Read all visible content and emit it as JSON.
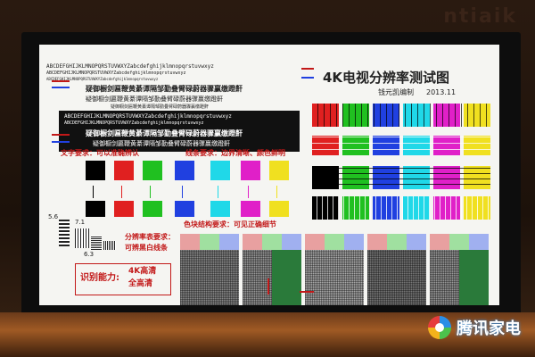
{
  "wall_sign": "ntiaik",
  "chart": {
    "title": "4K电视分辨率测试图",
    "author": "钱元凯编制",
    "year": "2013.11",
    "latin_line": "ABCDEFGHIJKLMNOPQRSTUVWXYZabcdefghijklmnopqrstuvwxyz",
    "cjk_line": "疑御橱剑匾鞭黄綦谭隔邹勤叠臂碌蔚器骤赢缴蹬鼾",
    "text_requirement": "文字要求：可以准确辨认",
    "line_requirement": "线条要求：边界清晰、颜色鲜明",
    "resolution_requirement_1": "分辨率表要求：",
    "resolution_requirement_2": "可辨黑白线条",
    "color_requirement": "色块结构要求：可见正确细节",
    "recognition_label": "识别能力:",
    "level_1": "4K高清",
    "level_2": "全高清",
    "res_digits": [
      "5.6",
      "7.1",
      "6.3"
    ]
  },
  "colors": {
    "red": "#e02020",
    "green": "#20c020",
    "blue": "#2040e0",
    "cyan": "#20d8e8",
    "magenta": "#e020c8",
    "yellow": "#f0e020",
    "white": "#ffffff",
    "black": "#000000",
    "annotation_red": "#c21818"
  },
  "watermark": {
    "brand": "腾讯家电",
    "icon": "tencent-home-appliance-logo-icon"
  }
}
